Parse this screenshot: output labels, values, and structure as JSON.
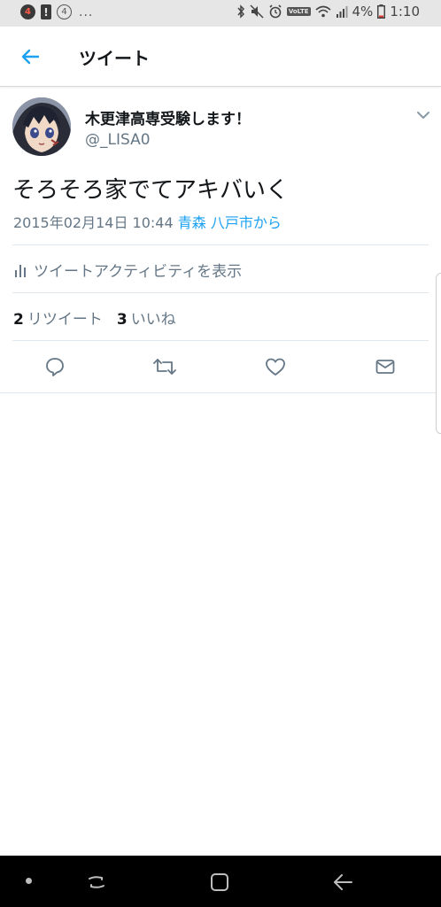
{
  "status_bar": {
    "notif_badge_red": "4",
    "notif_badge_outline": "4",
    "more": "...",
    "volte": "VoLTE",
    "battery": "4%",
    "time": "1:10"
  },
  "header": {
    "title": "ツイート"
  },
  "tweet": {
    "display_name": "木更津高専受験します！",
    "handle": "@_LISA0",
    "text": "そろそろ家でてアキバいく",
    "timestamp": "2015年02月14日 10:44",
    "location": "青森 八戸市から",
    "activity_label": "ツイートアクティビティを表示",
    "retweet_count": "2",
    "retweet_label": "リツイート",
    "like_count": "3",
    "like_label": "いいね"
  },
  "icons": {
    "back": "arrow-left-icon",
    "caret": "chevron-down-icon",
    "activity": "bar-chart-icon",
    "reply": "reply-bubble-icon",
    "retweet": "retweet-icon",
    "like": "heart-icon",
    "dm": "envelope-icon"
  },
  "colors": {
    "accent": "#1da1f2",
    "secondary_text": "#657786",
    "primary_text": "#14171a"
  }
}
